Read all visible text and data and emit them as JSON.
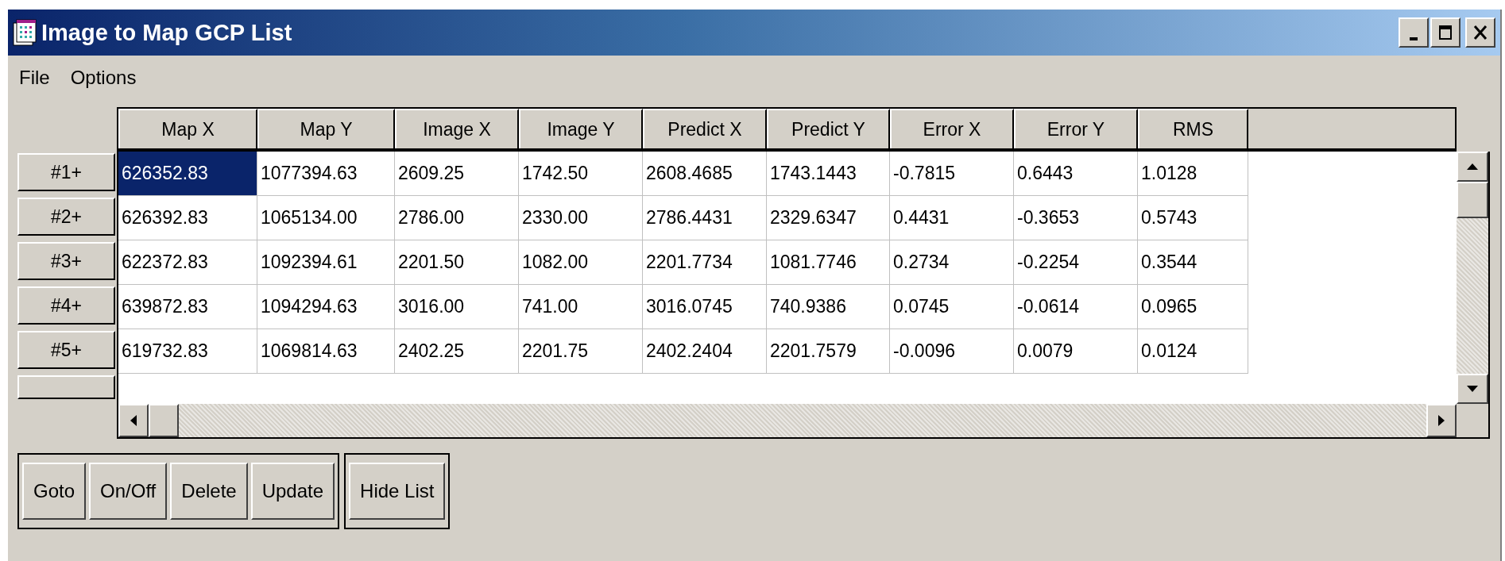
{
  "window": {
    "title": "Image to Map GCP List"
  },
  "menu": [
    "File",
    "Options"
  ],
  "table": {
    "columns": [
      "Map X",
      "Map Y",
      "Image X",
      "Image Y",
      "Predict X",
      "Predict Y",
      "Error X",
      "Error Y",
      "RMS"
    ],
    "rows": [
      {
        "label": "#1+",
        "cells": [
          {
            "text": "626352.83",
            "selected": true
          },
          {
            "text": "1077394.63",
            "selected": false
          },
          {
            "text": "2609.25",
            "selected": false
          },
          {
            "text": "1742.50",
            "selected": false
          },
          {
            "text": "2608.4685",
            "selected": false
          },
          {
            "text": "1743.1443",
            "selected": false
          },
          {
            "text": "-0.7815",
            "selected": false
          },
          {
            "text": "0.6443",
            "selected": false
          },
          {
            "text": "1.0128",
            "selected": false
          }
        ]
      },
      {
        "label": "#2+",
        "cells": [
          {
            "text": "626392.83",
            "selected": false
          },
          {
            "text": "1065134.00",
            "selected": false
          },
          {
            "text": "2786.00",
            "selected": false
          },
          {
            "text": "2330.00",
            "selected": false
          },
          {
            "text": "2786.4431",
            "selected": false
          },
          {
            "text": "2329.6347",
            "selected": false
          },
          {
            "text": "0.4431",
            "selected": false
          },
          {
            "text": "-0.3653",
            "selected": false
          },
          {
            "text": "0.5743",
            "selected": false
          }
        ]
      },
      {
        "label": "#3+",
        "cells": [
          {
            "text": "622372.83",
            "selected": false
          },
          {
            "text": "1092394.61",
            "selected": false
          },
          {
            "text": "2201.50",
            "selected": false
          },
          {
            "text": "1082.00",
            "selected": false
          },
          {
            "text": "2201.7734",
            "selected": false
          },
          {
            "text": "1081.7746",
            "selected": false
          },
          {
            "text": "0.2734",
            "selected": false
          },
          {
            "text": "-0.2254",
            "selected": false
          },
          {
            "text": "0.3544",
            "selected": false
          }
        ]
      },
      {
        "label": "#4+",
        "cells": [
          {
            "text": "639872.83",
            "selected": false
          },
          {
            "text": "1094294.63",
            "selected": false
          },
          {
            "text": "3016.00",
            "selected": false
          },
          {
            "text": "741.00",
            "selected": false
          },
          {
            "text": "3016.0745",
            "selected": false
          },
          {
            "text": "740.9386",
            "selected": false
          },
          {
            "text": "0.0745",
            "selected": false
          },
          {
            "text": "-0.0614",
            "selected": false
          },
          {
            "text": "0.0965",
            "selected": false
          }
        ]
      },
      {
        "label": "#5+",
        "cells": [
          {
            "text": "619732.83",
            "selected": false
          },
          {
            "text": "1069814.63",
            "selected": false
          },
          {
            "text": "2402.25",
            "selected": false
          },
          {
            "text": "2201.75",
            "selected": false
          },
          {
            "text": "2402.2404",
            "selected": false
          },
          {
            "text": "2201.7579",
            "selected": false
          },
          {
            "text": "-0.0096",
            "selected": false
          },
          {
            "text": "0.0079",
            "selected": false
          },
          {
            "text": "0.0124",
            "selected": false
          }
        ]
      }
    ]
  },
  "button_groups": [
    [
      "Goto",
      "On/Off",
      "Delete",
      "Update"
    ],
    [
      "Hide List"
    ]
  ]
}
